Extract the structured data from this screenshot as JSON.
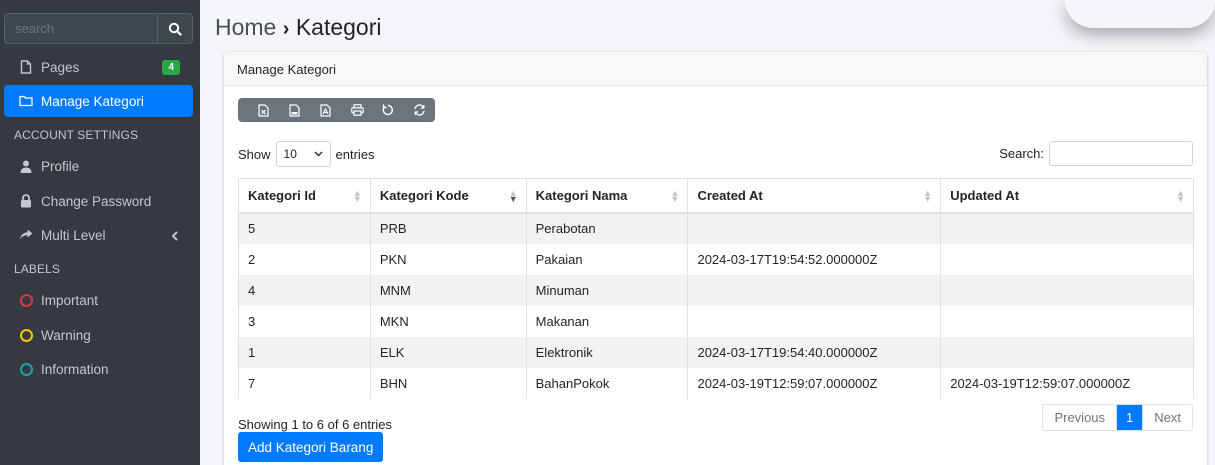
{
  "sidebar": {
    "search_placeholder": "search",
    "items": [
      {
        "label": "Pages",
        "badge": "4"
      },
      {
        "label": "Manage Kategori"
      }
    ],
    "account_header": "ACCOUNT SETTINGS",
    "account_items": [
      {
        "label": "Profile"
      },
      {
        "label": "Change Password"
      },
      {
        "label": "Multi Level"
      }
    ],
    "labels_header": "LABELS",
    "labels": [
      {
        "label": "Important",
        "color": "#dc3545"
      },
      {
        "label": "Warning",
        "color": "#ffc107"
      },
      {
        "label": "Information",
        "color": "#17a2b8"
      }
    ]
  },
  "breadcrumb": {
    "home": "Home",
    "separator": "›",
    "current": "Kategori"
  },
  "card": {
    "title": "Manage Kategori"
  },
  "toolbar": {
    "icons": [
      "excel-icon",
      "csv-icon",
      "pdf-icon",
      "print-icon",
      "reset-icon",
      "reload-icon"
    ]
  },
  "length": {
    "show": "Show",
    "value": "10",
    "entries": "entries"
  },
  "search": {
    "label": "Search:"
  },
  "table": {
    "headers": [
      "Kategori Id",
      "Kategori Kode",
      "Kategori Nama",
      "Created At",
      "Updated At"
    ],
    "rows": [
      [
        "5",
        "PRB",
        "Perabotan",
        "",
        ""
      ],
      [
        "2",
        "PKN",
        "Pakaian",
        "2024-03-17T19:54:52.000000Z",
        ""
      ],
      [
        "4",
        "MNM",
        "Minuman",
        "",
        ""
      ],
      [
        "3",
        "MKN",
        "Makanan",
        "",
        ""
      ],
      [
        "1",
        "ELK",
        "Elektronik",
        "2024-03-17T19:54:40.000000Z",
        ""
      ],
      [
        "7",
        "BHN",
        "BahanPokok",
        "2024-03-19T12:59:07.000000Z",
        "2024-03-19T12:59:07.000000Z"
      ]
    ]
  },
  "footer": {
    "info": "Showing 1 to 6 of 6 entries",
    "previous": "Previous",
    "page": "1",
    "next": "Next",
    "add_button": "Add Kategori Barang"
  },
  "colors": {
    "primary": "#007bff",
    "sidebar_bg": "#343a40",
    "badge": "#28a745"
  }
}
